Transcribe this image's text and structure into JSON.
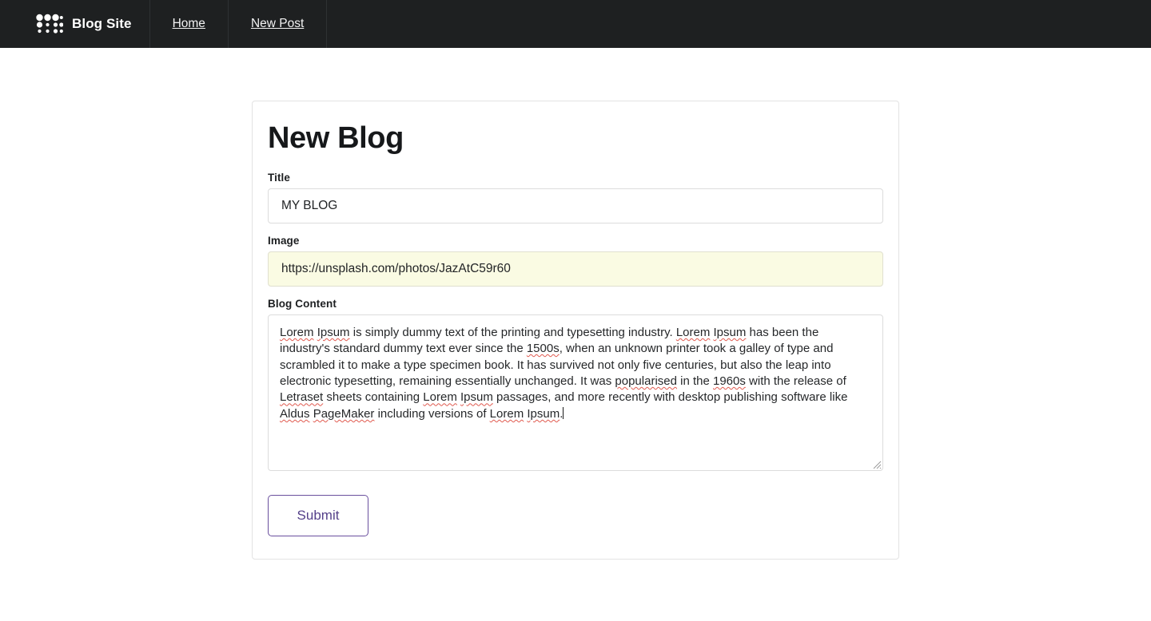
{
  "navbar": {
    "brand": {
      "label": "Blog Site",
      "logo_icon": "dot-grid-icon"
    },
    "links": [
      {
        "label": "Home"
      },
      {
        "label": "New Post"
      }
    ],
    "background_color": "#1e2021",
    "text_color": "#ffffff"
  },
  "card": {
    "heading": "New Blog",
    "fields": {
      "title": {
        "label": "Title",
        "value": "MY BLOG",
        "placeholder": "Title"
      },
      "image": {
        "label": "Image",
        "value": "https://unsplash.com/photos/JazAtC59r60",
        "placeholder": "Image",
        "autofill_color": "#fafbe3"
      },
      "content": {
        "label": "Blog Content",
        "placeholder": "Blog Content",
        "segments": [
          {
            "text": "Lorem",
            "spellcheck_error": true
          },
          {
            "text": " ",
            "spellcheck_error": false
          },
          {
            "text": "Ipsum",
            "spellcheck_error": true
          },
          {
            "text": " is simply dummy text of the printing and typesetting industry. ",
            "spellcheck_error": false
          },
          {
            "text": "Lorem",
            "spellcheck_error": true
          },
          {
            "text": " ",
            "spellcheck_error": false
          },
          {
            "text": "Ipsum",
            "spellcheck_error": true
          },
          {
            "text": " has been the industry's standard dummy text ever since the ",
            "spellcheck_error": false
          },
          {
            "text": "1500s",
            "spellcheck_error": true
          },
          {
            "text": ", when an unknown printer took a galley of type and scrambled it to make a type specimen book. It has survived not only five centuries, but also the leap into electronic typesetting, remaining essentially unchanged. It was ",
            "spellcheck_error": false
          },
          {
            "text": "popularised",
            "spellcheck_error": true
          },
          {
            "text": " in the ",
            "spellcheck_error": false
          },
          {
            "text": "1960s",
            "spellcheck_error": true
          },
          {
            "text": " with the release of ",
            "spellcheck_error": false
          },
          {
            "text": "Letraset",
            "spellcheck_error": true
          },
          {
            "text": " sheets containing ",
            "spellcheck_error": false
          },
          {
            "text": "Lorem",
            "spellcheck_error": true
          },
          {
            "text": " ",
            "spellcheck_error": false
          },
          {
            "text": "Ipsum",
            "spellcheck_error": true
          },
          {
            "text": " passages, and more recently with desktop publishing software like ",
            "spellcheck_error": false
          },
          {
            "text": "Aldus",
            "spellcheck_error": true
          },
          {
            "text": " ",
            "spellcheck_error": false
          },
          {
            "text": "PageMaker",
            "spellcheck_error": true
          },
          {
            "text": " including versions of ",
            "spellcheck_error": false
          },
          {
            "text": "Lorem",
            "spellcheck_error": true
          },
          {
            "text": " ",
            "spellcheck_error": false
          },
          {
            "text": "Ipsum",
            "spellcheck_error": true
          },
          {
            "text": ".",
            "spellcheck_error": false
          }
        ],
        "caret_visible": true
      }
    },
    "submit": {
      "label": "Submit",
      "accent_color": "#55418a",
      "border_color": "#6a4f9e"
    }
  }
}
